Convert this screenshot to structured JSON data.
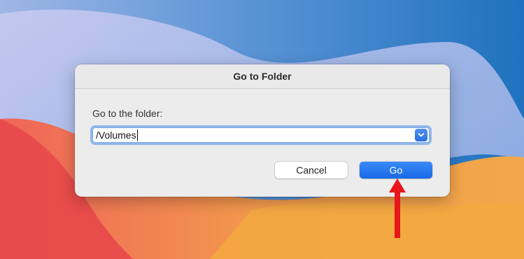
{
  "dialog": {
    "title": "Go to Folder",
    "prompt": "Go to the folder:",
    "path_value": "/Volumes",
    "cancel_label": "Cancel",
    "go_label": "Go"
  },
  "icons": {
    "dropdown": "chevron-down-icon",
    "annotation": "red-arrow-icon"
  },
  "colors": {
    "accent": "#1f6fe8",
    "annotation": "#e8151b"
  }
}
